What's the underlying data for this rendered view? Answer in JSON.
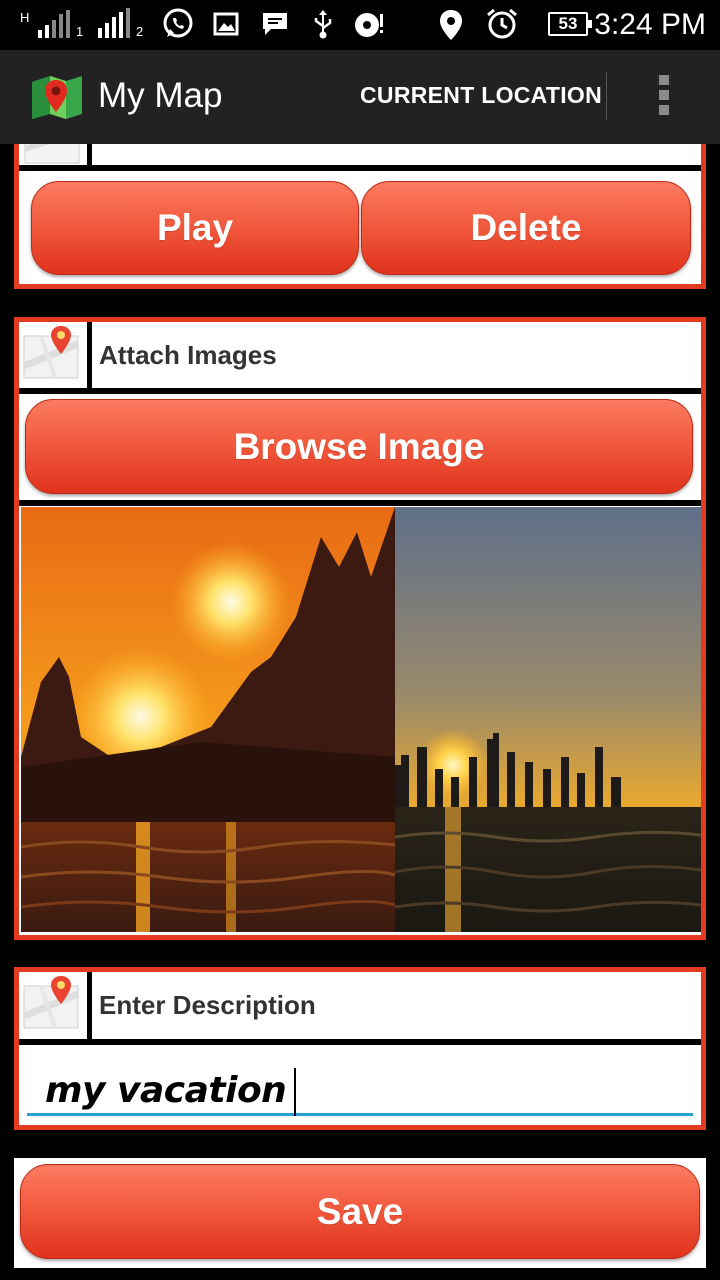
{
  "status_bar": {
    "network_label": "H",
    "sim1_label": "1",
    "sim2_label": "2",
    "battery_level": "53",
    "time": "3:24 PM",
    "icons": [
      "signal-icon",
      "whatsapp-icon",
      "gallery-icon",
      "message-icon",
      "usb-icon",
      "media-icon",
      "location-icon",
      "alarm-icon",
      "battery-icon"
    ]
  },
  "action_bar": {
    "title": "My Map",
    "current_location_label": "CURRENT LOCATION",
    "overflow_icon": "overflow-menu-icon"
  },
  "audio_card": {
    "play_label": "Play",
    "delete_label": "Delete"
  },
  "images_card": {
    "header_label": "Attach Images",
    "browse_label": "Browse Image",
    "images": [
      "sunset-mountains",
      "sunset-city-skyline"
    ]
  },
  "description_card": {
    "header_label": "Enter Description",
    "value": "my vacation"
  },
  "save_label": "Save",
  "colors": {
    "accent": "#e33b22",
    "button_top": "#fb7b61",
    "button_bottom": "#e0321c",
    "input_underline": "#2a9fd0",
    "action_bar": "#222222"
  }
}
